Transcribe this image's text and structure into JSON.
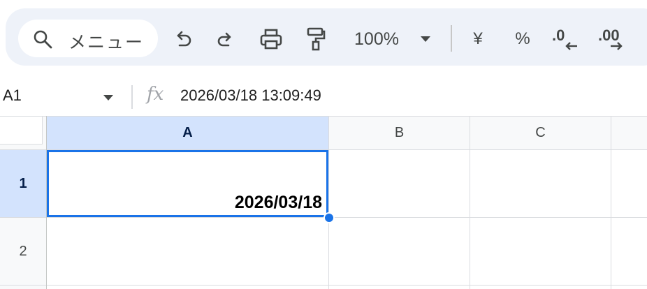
{
  "toolbar": {
    "menu_search_label": "メニュー",
    "zoom_value": "100%",
    "currency_label": "¥",
    "percent_label": "%",
    "decrease_decimal_label": ".0",
    "increase_decimal_label": ".00",
    "icons": [
      "search-icon",
      "undo-icon",
      "redo-icon",
      "print-icon",
      "paint-format-icon",
      "zoom-dropdown-icon",
      "decrease-decimal-icon",
      "increase-decimal-icon"
    ]
  },
  "formula_bar": {
    "name_box": "A1",
    "fx_label": "fx",
    "formula": "2026/03/18 13:09:49"
  },
  "grid": {
    "columns": [
      "A",
      "B",
      "C"
    ],
    "rows": [
      "1",
      "2"
    ],
    "selected_cell": "A1",
    "cells": {
      "A1": "2026/03/18"
    }
  },
  "colors": {
    "accent": "#1a73e8",
    "selected_header_bg": "#d3e3fd",
    "toolbar_bg": "#eef2f9"
  }
}
